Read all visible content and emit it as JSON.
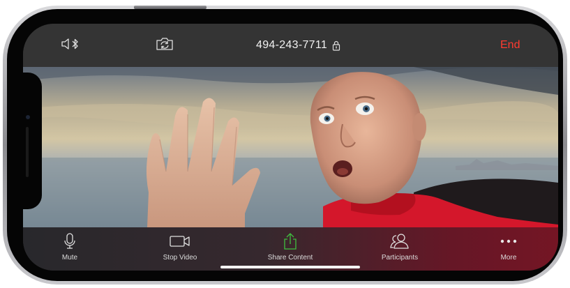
{
  "top_bar": {
    "audio_route_icon": "speaker-bluetooth-icon",
    "switch_camera_icon": "camera-rotate-icon",
    "meeting_id": "494-243-7711",
    "lock_icon": "lock-icon",
    "end_label": "End"
  },
  "bottom_bar": {
    "items": [
      {
        "label": "Mute",
        "icon": "microphone-icon"
      },
      {
        "label": "Stop Video",
        "icon": "video-camera-icon"
      },
      {
        "label": "Share Content",
        "icon": "share-upload-icon"
      },
      {
        "label": "Participants",
        "icon": "participants-icon"
      },
      {
        "label": "More",
        "icon": "ellipsis-icon"
      }
    ]
  },
  "colors": {
    "end": "#ff3b30",
    "share_icon": "#3fbf3f",
    "top_bar": "#343434",
    "shirt_red": "#d4172b"
  }
}
